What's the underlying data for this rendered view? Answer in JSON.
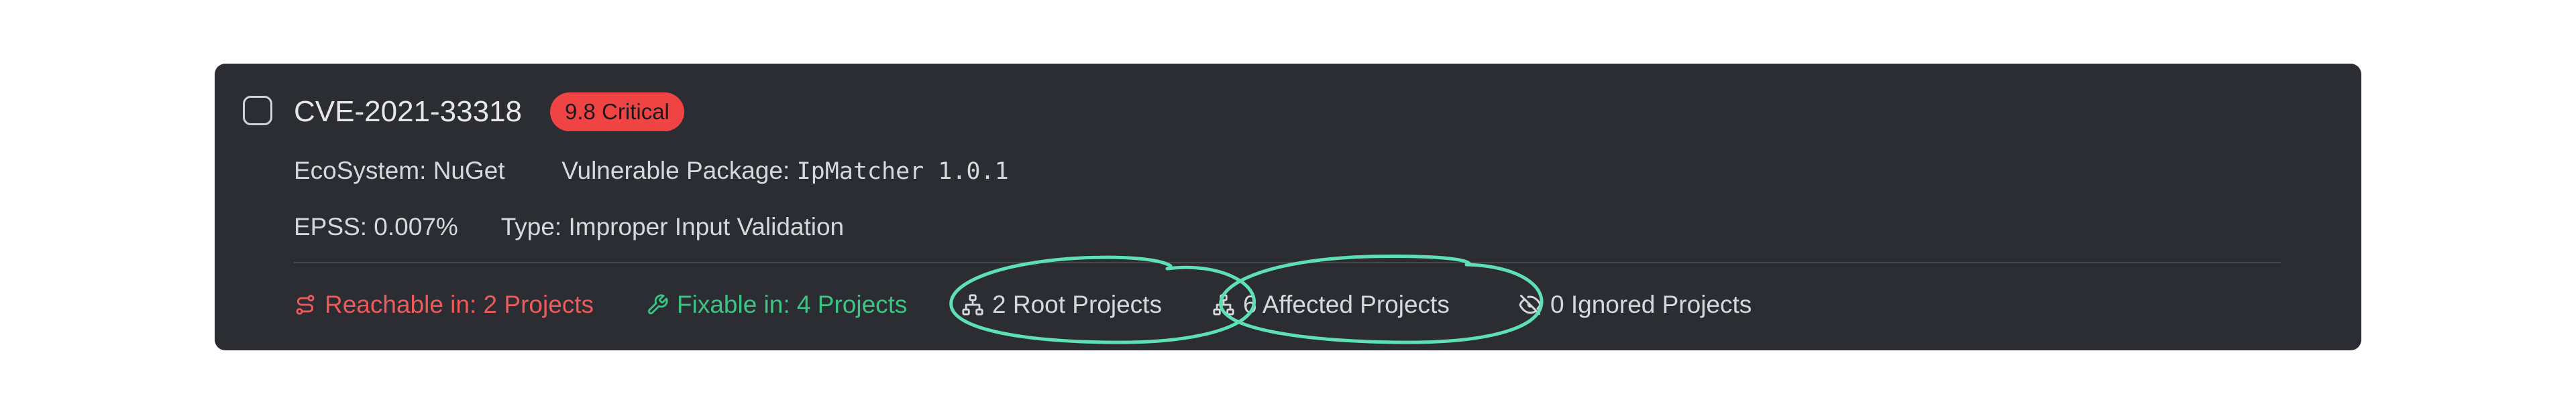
{
  "card": {
    "cve_id": "CVE-2021-33318",
    "severity_badge": "9.8 Critical",
    "ecosystem_label": "EcoSystem:",
    "ecosystem_value": "NuGet",
    "package_label": "Vulnerable Package:",
    "package_value": "IpMatcher 1.0.1",
    "epss_label": "EPSS:",
    "epss_value": "0.007%",
    "type_label": "Type:",
    "type_value": "Improper Input Validation"
  },
  "stats": {
    "reachable": "Reachable in: 2 Projects",
    "fixable": "Fixable in: 4 Projects",
    "root": "2 Root Projects",
    "affected": "6 Affected Projects",
    "ignored": "0 Ignored Projects"
  },
  "colors": {
    "card_bg": "#2b2d33",
    "critical": "#f04444",
    "reachable": "#ef5a5a",
    "fixable": "#3cc483",
    "highlight": "#5fe0b4"
  },
  "icons": {
    "reachable": "route-icon",
    "fixable": "wrench-icon",
    "root": "hierarchy-icon",
    "affected": "hierarchy-icon",
    "ignored": "eye-off-icon"
  }
}
